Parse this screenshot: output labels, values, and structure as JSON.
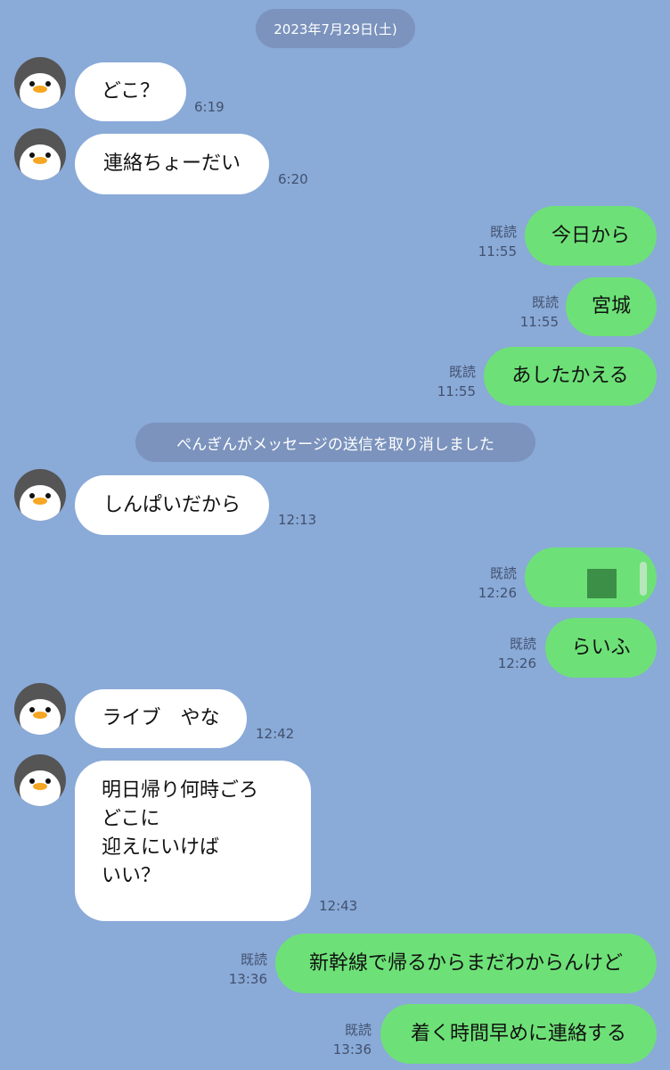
{
  "date_label": "2023年7月29日(土)",
  "system_notice": "ぺんぎんがメッセージの送信を取り消しました",
  "read_label": "既読",
  "messages": {
    "m1": {
      "text": "どこ？",
      "time": "6:19"
    },
    "m2": {
      "text": "連絡ちょーだい",
      "time": "6:20"
    },
    "m3": {
      "text": "今日から",
      "time": "11:55"
    },
    "m4": {
      "text": "宮城",
      "time": "11:55"
    },
    "m5": {
      "text": "あしたかえる",
      "time": "11:55"
    },
    "m6": {
      "text": "しんぱいだから",
      "time": "12:13"
    },
    "m7": {
      "text": "",
      "time": "12:26"
    },
    "m8": {
      "text": "らいふ",
      "time": "12:26"
    },
    "m9": {
      "text": "ライブ　やな",
      "time": "12:42"
    },
    "m10": {
      "text": "明日帰り何時ごろ\nどこに\n迎えにいけば\nいい？",
      "time": "12:43"
    },
    "m11": {
      "text": "新幹線で帰るからまだわからんけど",
      "time": "13:36"
    },
    "m12": {
      "text": "着く時間早めに連絡する",
      "time": "13:36"
    }
  },
  "colors": {
    "background": "#8aaad8",
    "incoming_bubble": "#ffffff",
    "outgoing_bubble": "#6de177"
  }
}
